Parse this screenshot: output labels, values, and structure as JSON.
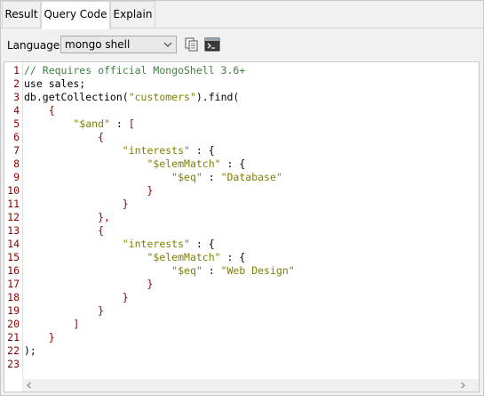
{
  "tabs": [
    {
      "label": "Result",
      "active": false
    },
    {
      "label": "Query Code",
      "active": true
    },
    {
      "label": "Explain",
      "active": false
    }
  ],
  "toolbar": {
    "language_label": "Language:",
    "language_value": "mongo shell",
    "icons": [
      "copy-icon",
      "terminal-icon"
    ]
  },
  "editor": {
    "line_numbers": [
      "1",
      "2",
      "3",
      "4",
      "5",
      "6",
      "7",
      "8",
      "9",
      "10",
      "11",
      "12",
      "13",
      "14",
      "15",
      "16",
      "17",
      "18",
      "19",
      "20",
      "21",
      "22",
      "23"
    ],
    "lines": [
      [
        {
          "t": "comment",
          "v": "// Requires official MongoShell 3.6+"
        }
      ],
      [
        {
          "t": "plain",
          "v": "use sales;"
        }
      ],
      [
        {
          "t": "plain",
          "v": "db.getCollection("
        },
        {
          "t": "string",
          "v": "\"customers\""
        },
        {
          "t": "plain",
          "v": ").find("
        }
      ],
      [
        {
          "t": "plain",
          "v": "    "
        },
        {
          "t": "brace",
          "v": "{"
        }
      ],
      [
        {
          "t": "plain",
          "v": "        "
        },
        {
          "t": "string",
          "v": "\"$and\""
        },
        {
          "t": "plain",
          "v": " : "
        },
        {
          "t": "brace",
          "v": "["
        }
      ],
      [
        {
          "t": "plain",
          "v": "            "
        },
        {
          "t": "brace",
          "v": "{"
        }
      ],
      [
        {
          "t": "plain",
          "v": "                "
        },
        {
          "t": "string",
          "v": "\"interests\""
        },
        {
          "t": "plain",
          "v": " : {"
        }
      ],
      [
        {
          "t": "plain",
          "v": "                    "
        },
        {
          "t": "string",
          "v": "\"$elemMatch\""
        },
        {
          "t": "plain",
          "v": " : {"
        }
      ],
      [
        {
          "t": "plain",
          "v": "                        "
        },
        {
          "t": "string",
          "v": "\"$eq\""
        },
        {
          "t": "plain",
          "v": " : "
        },
        {
          "t": "string",
          "v": "\"Database\""
        }
      ],
      [
        {
          "t": "plain",
          "v": "                    "
        },
        {
          "t": "brace",
          "v": "}"
        }
      ],
      [
        {
          "t": "plain",
          "v": "                "
        },
        {
          "t": "brace",
          "v": "}"
        }
      ],
      [
        {
          "t": "plain",
          "v": "            "
        },
        {
          "t": "brace",
          "v": "},"
        }
      ],
      [
        {
          "t": "plain",
          "v": "            "
        },
        {
          "t": "brace",
          "v": "{"
        }
      ],
      [
        {
          "t": "plain",
          "v": "                "
        },
        {
          "t": "string",
          "v": "\"interests\""
        },
        {
          "t": "plain",
          "v": " : {"
        }
      ],
      [
        {
          "t": "plain",
          "v": "                    "
        },
        {
          "t": "string",
          "v": "\"$elemMatch\""
        },
        {
          "t": "plain",
          "v": " : {"
        }
      ],
      [
        {
          "t": "plain",
          "v": "                        "
        },
        {
          "t": "string",
          "v": "\"$eq\""
        },
        {
          "t": "plain",
          "v": " : "
        },
        {
          "t": "string",
          "v": "\"Web Design\""
        }
      ],
      [
        {
          "t": "plain",
          "v": "                    "
        },
        {
          "t": "brace",
          "v": "}"
        }
      ],
      [
        {
          "t": "plain",
          "v": "                "
        },
        {
          "t": "brace",
          "v": "}"
        }
      ],
      [
        {
          "t": "plain",
          "v": "            "
        },
        {
          "t": "brace",
          "v": "}"
        }
      ],
      [
        {
          "t": "plain",
          "v": "        "
        },
        {
          "t": "brace",
          "v": "]"
        }
      ],
      [
        {
          "t": "plain",
          "v": "    "
        },
        {
          "t": "brace",
          "v": "}"
        }
      ],
      [
        {
          "t": "plain",
          "v": ");"
        }
      ],
      [
        {
          "t": "plain",
          "v": ""
        }
      ]
    ]
  },
  "colors": {
    "comment": "#3f7f3f",
    "string": "#7f7f00",
    "brace": "#8b0000",
    "line_number": "#8b0000"
  }
}
